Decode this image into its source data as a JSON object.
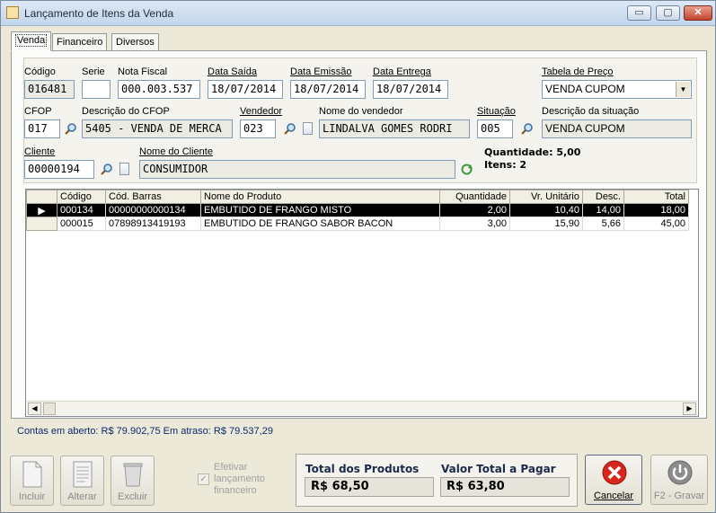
{
  "window": {
    "title": "Lançamento de Itens da Venda"
  },
  "window_controls": {
    "minimize": "▭",
    "maximize": "▢",
    "close": "✕"
  },
  "tabs": [
    {
      "label": "Venda"
    },
    {
      "label": "Financeiro"
    },
    {
      "label": "Diversos"
    }
  ],
  "form": {
    "codigo": {
      "label": "Código",
      "value": "016481"
    },
    "serie": {
      "label": "Serie",
      "value": ""
    },
    "nota_fiscal": {
      "label": "Nota Fiscal",
      "value": "000.003.537"
    },
    "data_saida": {
      "label": "Data Saída",
      "value": "18/07/2014"
    },
    "data_emissao": {
      "label": "Data Emissão",
      "value": "18/07/2014"
    },
    "data_entrega": {
      "label": "Data Entrega",
      "value": "18/07/2014"
    },
    "tabela_preco": {
      "label": "Tabela de Preço",
      "value": "VENDA CUPOM"
    },
    "cfop": {
      "label": "CFOP",
      "value": "017"
    },
    "descricao_cfop": {
      "label": "Descrição do CFOP",
      "value": "5405 - VENDA DE MERCA"
    },
    "vendedor": {
      "label": "Vendedor",
      "value": "023"
    },
    "nome_vendedor": {
      "label": "Nome do vendedor",
      "value": "LINDALVA GOMES RODRI"
    },
    "situacao": {
      "label": "Situação",
      "value": "005"
    },
    "descricao_situacao": {
      "label": "Descrição da situação",
      "value": "VENDA CUPOM"
    },
    "cliente": {
      "label": "Cliente",
      "value": "00000194"
    },
    "nome_cliente": {
      "label": "Nome do Cliente",
      "value": "CONSUMIDOR"
    },
    "quantidade": "Quantidade: 5,00",
    "itens": "Itens: 2"
  },
  "grid": {
    "columns": [
      "Código",
      "Cód. Barras",
      "Nome do Produto",
      "Quantidade",
      "Vr. Unitário",
      "Desc.",
      "Total"
    ],
    "rows": [
      {
        "codigo": "000134",
        "barras": "00000000000134",
        "nome": "EMBUTIDO DE FRANGO MISTO",
        "qtd": "2,00",
        "unit": "10,40",
        "desc": "14,00",
        "total": "18,00"
      },
      {
        "codigo": "000015",
        "barras": "07898913419193",
        "nome": "EMBUTIDO DE FRANGO SABOR BACON",
        "qtd": "3,00",
        "unit": "15,90",
        "desc": "5,66",
        "total": "45,00"
      }
    ]
  },
  "status": {
    "text": "Contas em aberto: R$ 79.902,75  Em atraso: R$ 79.537,29"
  },
  "buttons": {
    "incluir": "Incluir",
    "alterar": "Alterar",
    "excluir": "Excluir",
    "cancelar": "Cancelar",
    "gravar": "F2 - Gravar"
  },
  "efetivar": {
    "label": "Efetivar lançamento financeiro",
    "checked": true,
    "mark": "✓"
  },
  "totals": {
    "produtos_label": "Total dos Produtos",
    "produtos_value": "R$ 68,50",
    "pagar_label": "Valor Total a Pagar",
    "pagar_value": "R$ 63,80"
  },
  "icons": {
    "lookup": "magnifier-icon",
    "new": "document-icon",
    "refresh": "refresh-icon"
  }
}
